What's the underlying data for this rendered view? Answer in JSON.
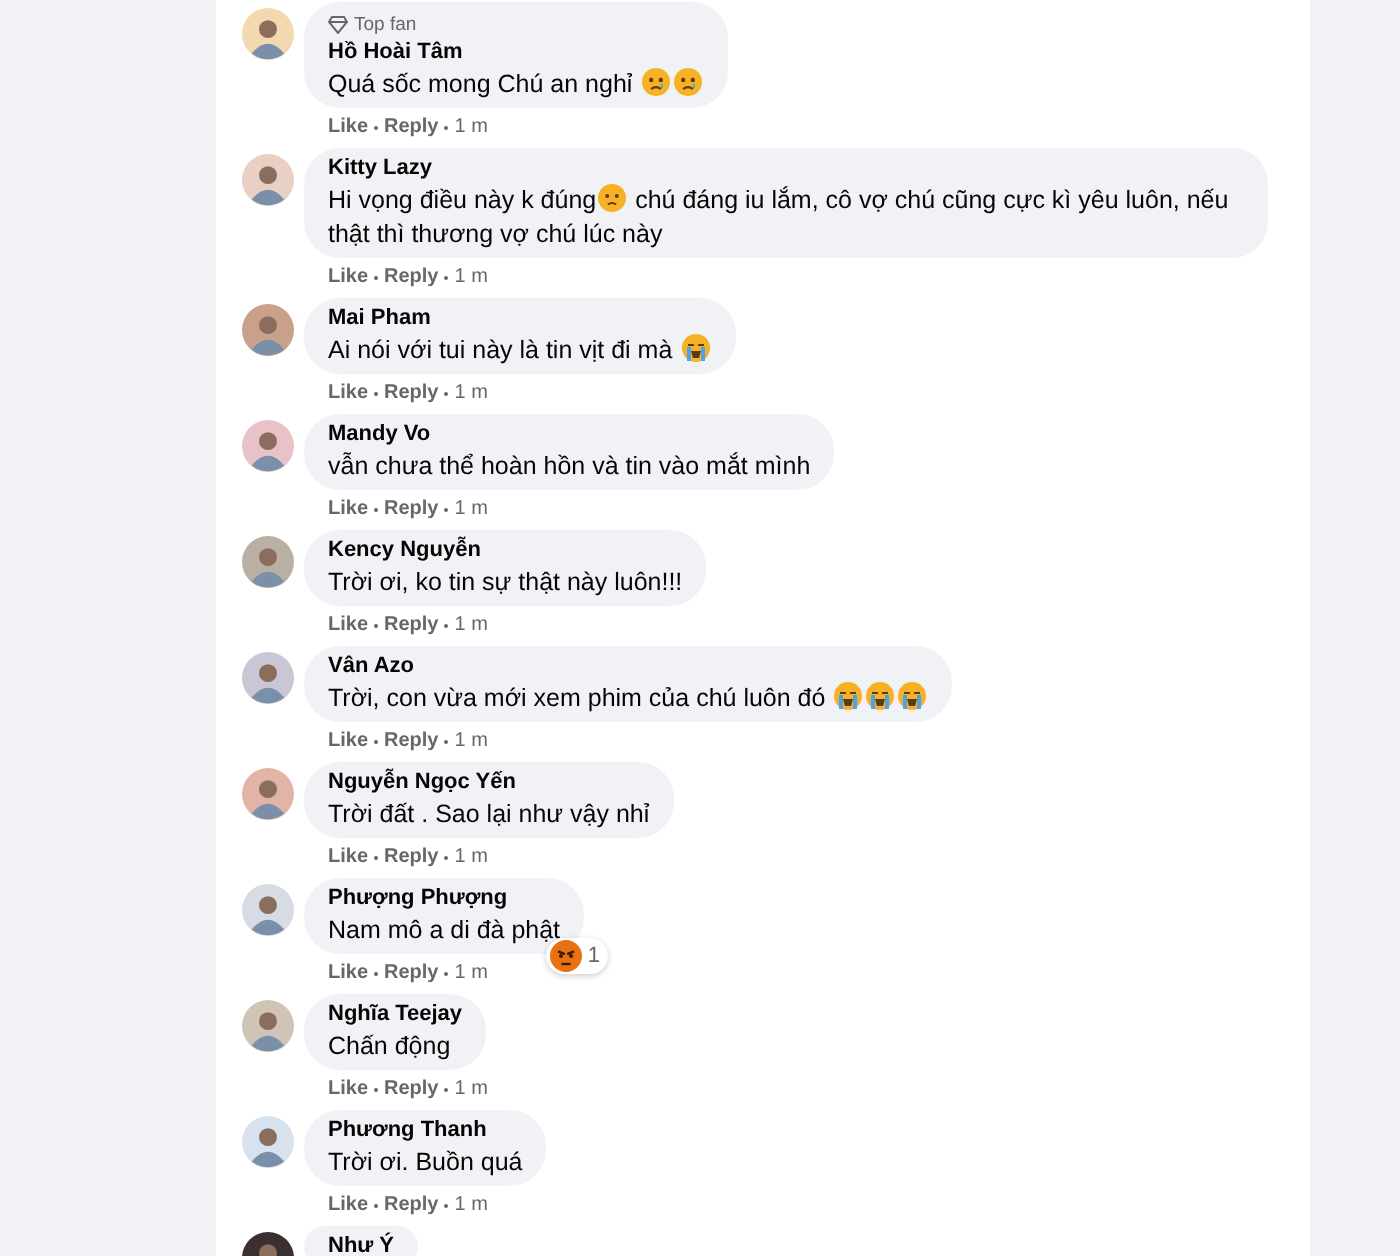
{
  "comments": [
    {
      "author": "Hồ Hoài Tâm",
      "badge": "Top fan",
      "parts": [
        {
          "kind": "text",
          "text": "Quá sốc mong Chú an nghỉ "
        },
        {
          "kind": "sad"
        },
        {
          "kind": "sad"
        }
      ],
      "actions": [
        "Like",
        "Reply"
      ],
      "time": "1 m"
    },
    {
      "author": "Kitty Lazy",
      "parts": [
        {
          "kind": "text",
          "text": "Hi vọng điều này k đúng"
        },
        {
          "kind": "worried"
        },
        {
          "kind": "text",
          "text": " chú đáng iu lắm, cô vợ chú cũng cực kì yêu luôn, nếu thật thì thương vợ chú lúc này"
        }
      ],
      "actions": [
        "Like",
        "Reply"
      ],
      "time": "1 m"
    },
    {
      "author": "Mai Pham",
      "parts": [
        {
          "kind": "text",
          "text": "Ai nói với tui này là tin vịt đi mà "
        },
        {
          "kind": "crying"
        }
      ],
      "actions": [
        "Like",
        "Reply"
      ],
      "time": "1 m"
    },
    {
      "author": "Mandy Vo",
      "parts": [
        {
          "kind": "text",
          "text": "vẫn chưa thể hoàn hồn và tin vào mắt mình"
        }
      ],
      "actions": [
        "Like",
        "Reply"
      ],
      "time": "1 m"
    },
    {
      "author": "Kency Nguyễn",
      "parts": [
        {
          "kind": "text",
          "text": "Trời ơi, ko tin sự thật này luôn!!!"
        }
      ],
      "actions": [
        "Like",
        "Reply"
      ],
      "time": "1 m"
    },
    {
      "author": "Vân Azo",
      "parts": [
        {
          "kind": "text",
          "text": "Trời, con vừa mới xem phim của chú luôn đó "
        },
        {
          "kind": "crying"
        },
        {
          "kind": "crying"
        },
        {
          "kind": "crying"
        }
      ],
      "actions": [
        "Like",
        "Reply"
      ],
      "time": "1 m"
    },
    {
      "author": "Nguyễn Ngọc Yến",
      "parts": [
        {
          "kind": "text",
          "text": "Trời đất . Sao lại như vậy nhỉ"
        }
      ],
      "actions": [
        "Like",
        "Reply"
      ],
      "time": "1 m"
    },
    {
      "author": "Phượng Phượng",
      "parts": [
        {
          "kind": "text",
          "text": "Nam mô a di đà phật"
        }
      ],
      "reaction": {
        "kind": "angry",
        "count": "1"
      },
      "actions": [
        "Like",
        "Reply"
      ],
      "time": "1 m"
    },
    {
      "author": "Nghĩa Teejay",
      "parts": [
        {
          "kind": "text",
          "text": "Chấn động"
        }
      ],
      "actions": [
        "Like",
        "Reply"
      ],
      "time": "1 m"
    },
    {
      "author": "Phương Thanh",
      "parts": [
        {
          "kind": "text",
          "text": "Trời ơi. Buồn quá"
        }
      ],
      "actions": [
        "Like",
        "Reply"
      ],
      "time": "1 m"
    },
    {
      "author": "Như Ý"
    }
  ]
}
